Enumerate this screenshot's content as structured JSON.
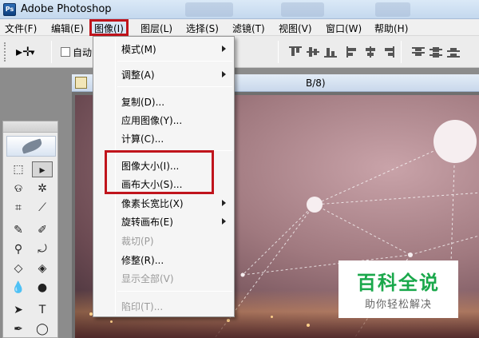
{
  "app": {
    "title": "Adobe Photoshop"
  },
  "menubar": {
    "items": [
      "文件(F)",
      "编辑(E)",
      "图像(I)",
      "图层(L)",
      "选择(S)",
      "滤镜(T)",
      "视图(V)",
      "窗口(W)",
      "帮助(H)"
    ],
    "active": "图像(I)"
  },
  "options": {
    "auto_select_label": "自动"
  },
  "document": {
    "title_fragment": "B/8)"
  },
  "image_menu": {
    "items": [
      {
        "label": "模式(M)",
        "submenu": true,
        "enabled": true
      },
      {
        "label": "调整(A)",
        "submenu": true,
        "enabled": true
      },
      {
        "label": "复制(D)...",
        "submenu": false,
        "enabled": true
      },
      {
        "label": "应用图像(Y)...",
        "submenu": false,
        "enabled": true
      },
      {
        "label": "计算(C)...",
        "submenu": false,
        "enabled": true
      },
      {
        "label": "图像大小(I)...",
        "submenu": false,
        "enabled": true
      },
      {
        "label": "画布大小(S)...",
        "submenu": false,
        "enabled": true
      },
      {
        "label": "像素长宽比(X)",
        "submenu": true,
        "enabled": true
      },
      {
        "label": "旋转画布(E)",
        "submenu": true,
        "enabled": true
      },
      {
        "label": "裁切(P)",
        "submenu": false,
        "enabled": false
      },
      {
        "label": "修整(R)...",
        "submenu": false,
        "enabled": true
      },
      {
        "label": "显示全部(V)",
        "submenu": false,
        "enabled": false
      },
      {
        "label": "陷印(T)...",
        "submenu": false,
        "enabled": false
      }
    ]
  },
  "watermark": {
    "main": "百科全说",
    "sub": "助你轻松解决"
  },
  "colors": {
    "highlight": "#c0141c",
    "watermark_green": "#1aa84b"
  }
}
